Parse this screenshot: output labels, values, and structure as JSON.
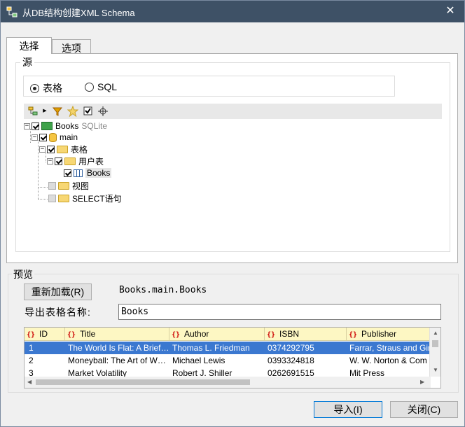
{
  "window": {
    "title": "从DB结构创建XML Schema",
    "close_glyph": "✕"
  },
  "tabs": [
    {
      "label": "选择",
      "active": true
    },
    {
      "label": "选项",
      "active": false
    }
  ],
  "source": {
    "group_label": "源",
    "radios": [
      {
        "label": "表格",
        "selected": true
      },
      {
        "label": "SQL",
        "selected": false
      }
    ],
    "toolbar_icons": [
      "add-node-icon",
      "arrow-right-icon",
      "filter-icon",
      "favorite-star-icon",
      "checkbox-icon",
      "locate-icon"
    ]
  },
  "tree": {
    "root": {
      "label": "Books",
      "sublabel": "SQLite",
      "checked": true
    },
    "schema": {
      "label": "main",
      "checked": true
    },
    "tables_folder": {
      "label": "表格",
      "checked": true
    },
    "user_tables_folder": {
      "label": "用户表",
      "checked": true
    },
    "books_table": {
      "label": "Books",
      "checked": true
    },
    "views_folder": {
      "label": "视图",
      "checked": false
    },
    "select_folder": {
      "label": "SELECT语句",
      "checked": false
    }
  },
  "preview": {
    "group_label": "预览",
    "reload_button": "重新加载(R)",
    "path": "Books.main.Books",
    "export_label": "导出表格名称:",
    "export_value": "Books",
    "columns": [
      "ID",
      "Title",
      "Author",
      "ISBN",
      "Publisher"
    ],
    "rows": [
      [
        "1",
        "The World Is Flat: A Brief…",
        "Thomas L. Friedman",
        "0374292795",
        "Farrar, Straus and Giro"
      ],
      [
        "2",
        "Moneyball: The Art of W…",
        "Michael Lewis",
        "0393324818",
        "W. W. Norton & Com"
      ],
      [
        "3",
        "Market Volatility",
        "Robert J. Shiller",
        "0262691515",
        "Mit Press"
      ]
    ]
  },
  "footer": {
    "import_button": "导入(I)",
    "close_button": "关闭(C)"
  },
  "colors": {
    "titlebar": "#3e5166",
    "selected_row": "#3b78d0",
    "grid_header": "#fdf7c3"
  }
}
